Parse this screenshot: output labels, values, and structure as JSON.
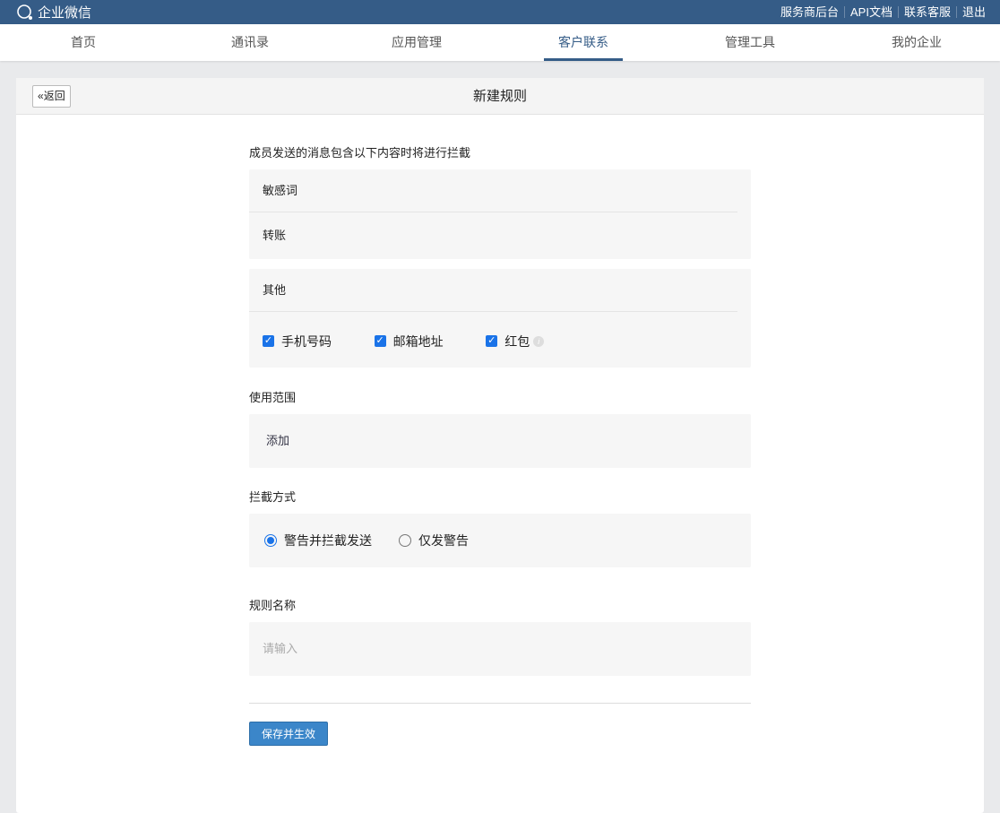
{
  "topbar": {
    "brand": "企业微信",
    "links": [
      "服务商后台",
      "API文档",
      "联系客服",
      "退出"
    ]
  },
  "nav": {
    "items": [
      "首页",
      "通讯录",
      "应用管理",
      "客户联系",
      "管理工具",
      "我的企业"
    ],
    "active": 3
  },
  "page": {
    "title": "新建规则",
    "back": "返回"
  },
  "form": {
    "intercept_label": "成员发送的消息包含以下内容时将进行拦截",
    "sensitive_header": "敏感词",
    "sensitive_value": "转账",
    "other_header": "其他",
    "options": [
      {
        "label": "手机号码",
        "checked": true
      },
      {
        "label": "邮箱地址",
        "checked": true
      },
      {
        "label": "红包",
        "checked": true
      }
    ],
    "scope_label": "使用范围",
    "scope_add": "添加",
    "mode_label": "拦截方式",
    "modes": [
      {
        "label": "警告并拦截发送",
        "selected": true
      },
      {
        "label": "仅发警告",
        "selected": false
      }
    ],
    "name_label": "规则名称",
    "name_placeholder": "请输入",
    "save": "保存并生效"
  }
}
